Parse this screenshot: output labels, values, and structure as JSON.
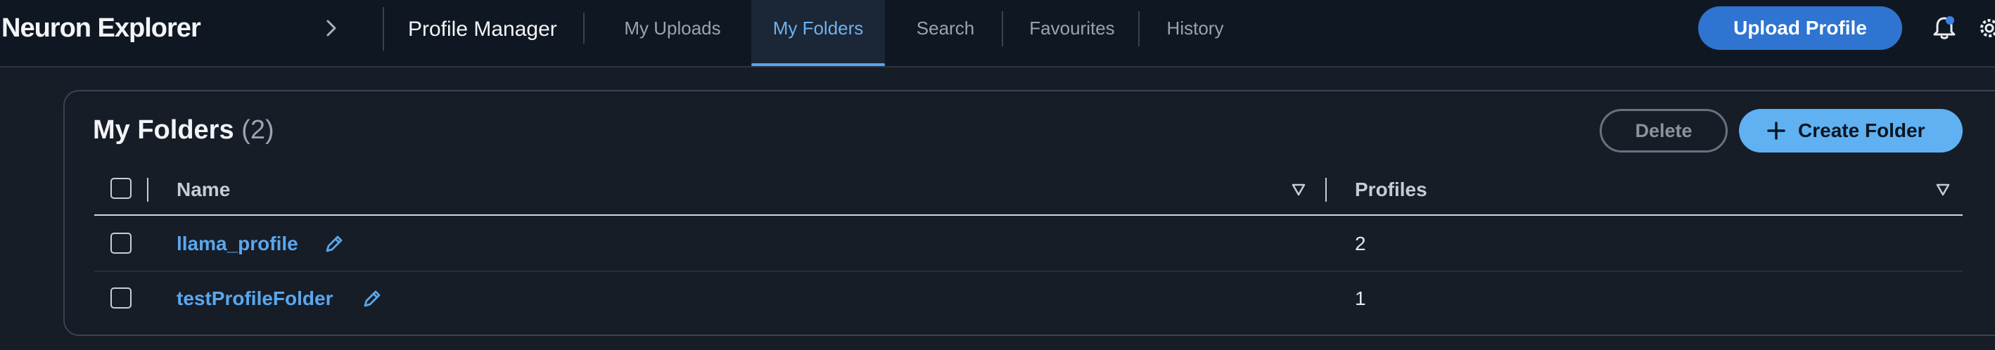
{
  "nav": {
    "brand": "Neuron Explorer",
    "app_name": "Profile Manager",
    "tabs": [
      {
        "label": "My Uploads",
        "active": false
      },
      {
        "label": "My Folders",
        "active": true
      },
      {
        "label": "Search",
        "active": false
      },
      {
        "label": "Favourites",
        "active": false
      },
      {
        "label": "History",
        "active": false
      }
    ],
    "upload_label": "Upload Profile"
  },
  "panel": {
    "title": "My Folders",
    "count": "(2)",
    "delete_label": "Delete",
    "create_label": "Create Folder",
    "columns": [
      "Name",
      "Profiles"
    ],
    "rows": [
      {
        "name": "llama_profile",
        "profiles": "2"
      },
      {
        "name": "testProfileFolder",
        "profiles": "1"
      }
    ]
  },
  "colors": {
    "accent": "#2f74d0",
    "link": "#5aa7ee",
    "create_button": "#5fb1f2",
    "background": "#161d27",
    "topbar": "#0f1722"
  },
  "icons": [
    "chevron-right-icon",
    "bell-icon",
    "gear-icon",
    "plus-icon",
    "sort-icon",
    "pencil-icon"
  ]
}
